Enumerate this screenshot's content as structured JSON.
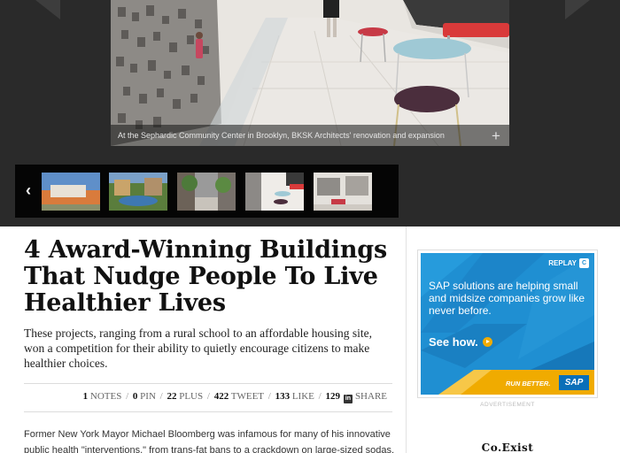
{
  "gallery": {
    "caption": "At the Sephardic Community Center in Brooklyn, BKSK Architects' renovation and expansion",
    "caption_expand": "+",
    "thumbnails_prev": "‹",
    "thumbnails": [
      {
        "icon": "building-exterior-thumbnail"
      },
      {
        "icon": "courtyard-thumbnail"
      },
      {
        "icon": "street-thumbnail"
      },
      {
        "icon": "interior-hall-thumbnail"
      },
      {
        "icon": "lobby-thumbnail"
      }
    ]
  },
  "article": {
    "headline": "4 Award-Winning Buildings That Nudge People To Live Healthier Lives",
    "dek": "These projects, ranging from a rural school to an affordable housing site, won a competition for their ability to quietly encourage citizens to make healthier choices.",
    "share": {
      "notes_count": "1",
      "notes_label": "NOTES",
      "pin_count": "0",
      "pin_label": "PIN",
      "plus_count": "22",
      "plus_label": "PLUS",
      "tweet_count": "422",
      "tweet_label": "TWEET",
      "like_count": "133",
      "like_label": "LIKE",
      "linkedin_count": "129",
      "linkedin_label": "SHARE"
    },
    "body": "Former New York Mayor Michael Bloomberg was infamous for many of his innovative public health \"interventions,\" from trans-fat bans to a crackdown on large-sized sodas."
  },
  "sidebar": {
    "ad": {
      "replay": "REPLAY",
      "headline": "SAP solutions are helping small and midsize companies grow like never before.",
      "cta": "See how.",
      "tagline": "RUN BETTER.",
      "logo": "SAP",
      "label": "ADVERTISEMENT"
    },
    "brand": "Co.Exist"
  },
  "colors": {
    "gallery_bg": "#2a2a2a",
    "thumb_strip_bg": "#050505",
    "ad_blue": "#1f8fd2",
    "ad_yellow": "#f0ab00",
    "text": "#111111"
  }
}
